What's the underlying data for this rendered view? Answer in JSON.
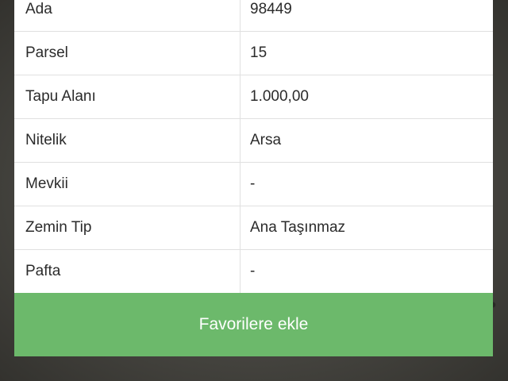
{
  "details": {
    "rows": [
      {
        "label": "Ada",
        "value": "98449"
      },
      {
        "label": "Parsel",
        "value": "15"
      },
      {
        "label": "Tapu Alanı",
        "value": "1.000,00"
      },
      {
        "label": "Nitelik",
        "value": "Arsa"
      },
      {
        "label": "Mevkii",
        "value": "-"
      },
      {
        "label": "Zemin Tip",
        "value": "Ana Taşınmaz"
      },
      {
        "label": "Pafta",
        "value": "-"
      }
    ]
  },
  "actions": {
    "favorite_label": "Favorilere ekle"
  },
  "colors": {
    "button": "#6cb96b",
    "row_bg": "#ffffff",
    "divider": "#e0e0e0"
  }
}
